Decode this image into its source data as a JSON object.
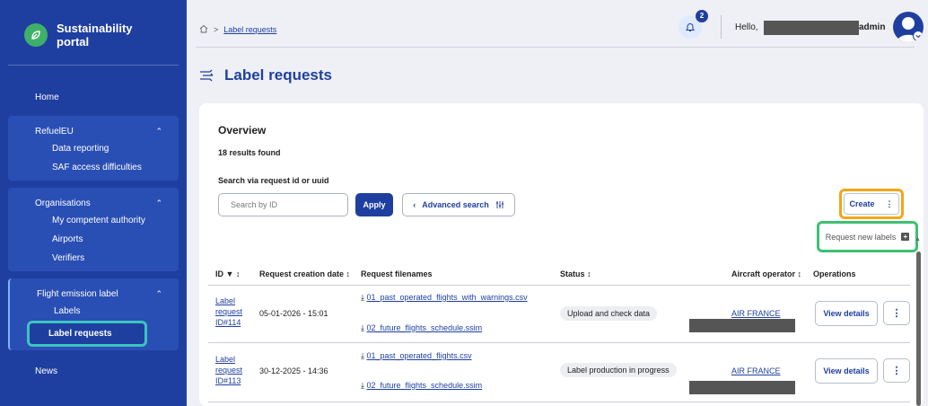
{
  "brand": {
    "title_line1": "Sustainability",
    "title_line2": "portal"
  },
  "sidebar": {
    "home": "Home",
    "groups": [
      {
        "label": "RefuelEU",
        "items": [
          "Data reporting",
          "SAF access difficulties"
        ]
      },
      {
        "label": "Organisations",
        "items": [
          "My competent authority",
          "Airports",
          "Verifiers"
        ]
      },
      {
        "label": "Flight emission label",
        "items": [
          "Labels",
          "Label requests"
        ]
      }
    ],
    "news": "News"
  },
  "breadcrumb": {
    "current": "Label requests"
  },
  "header": {
    "notification_count": "2",
    "greeting": "Hello,",
    "username": "admin"
  },
  "page": {
    "title": "Label requests"
  },
  "overview": {
    "title": "Overview",
    "results": "18 results found",
    "search_label": "Search via request id or uuid",
    "search_placeholder": "Search by ID",
    "apply_label": "Apply",
    "advanced_label": "Advanced search",
    "create_label": "Create",
    "request_new_labels": "Request new labels"
  },
  "table": {
    "headers": [
      "ID",
      "Request creation date",
      "Request filenames",
      "Status",
      "Aircraft operator",
      "Operations"
    ],
    "rows": [
      {
        "id_l1": "Label",
        "id_l2": "request",
        "id_l3": "ID#114",
        "date": "05-01-2026 - 15:01",
        "file1": "01_past_operated_flights_with_warnings.csv",
        "file2": "02_future_flights_schedule.ssim",
        "status": "Upload and check data",
        "operator": "AIR FRANCE",
        "view": "View details"
      },
      {
        "id_l1": "Label",
        "id_l2": "request",
        "id_l3": "ID#113",
        "date": "30-12-2025 - 14:36",
        "file1": "01_past_operated_flights.csv",
        "file2": "02_future_flights_schedule.ssim",
        "status": "Label production in progress",
        "operator": "AIR FRANCE",
        "view": "View details"
      }
    ]
  },
  "colors": {
    "primary": "#1f3fa0",
    "create_highlight": "#f2a618",
    "menu_highlight": "#3cc173",
    "active_highlight": "#3dc3c0"
  }
}
